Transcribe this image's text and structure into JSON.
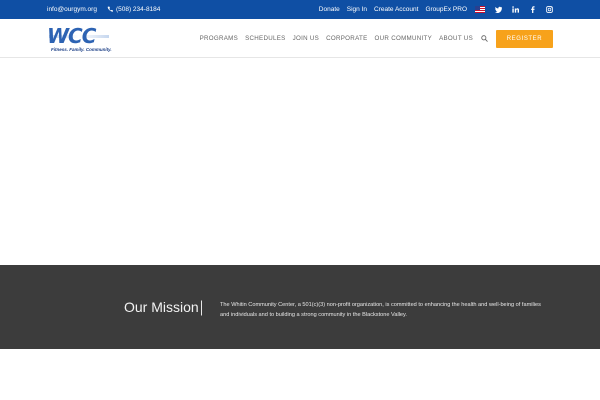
{
  "topbar": {
    "email": "info@ourgym.org",
    "phone": "(508) 234-8184",
    "links": [
      "Donate",
      "Sign In",
      "Create Account",
      "GroupEx PRO"
    ]
  },
  "header": {
    "logo_letters": "WCC",
    "logo_tagline": "Fitness. Family. Community.",
    "nav": [
      "PROGRAMS",
      "SCHEDULES",
      "JOIN US",
      "CORPORATE",
      "OUR COMMUNITY",
      "ABOUT US"
    ],
    "register_label": "REGISTER"
  },
  "mission": {
    "title": "Our Mission",
    "text": "The Whitin Community Center, a 501(c)(3) non-profit organization, is committed to enhancing the health and well-being of families and individuals and to building a strong community in the Blackstone Valley."
  },
  "colors": {
    "topbar": "#0f4fa4",
    "accent": "#f7a21b",
    "mission_band": "#3c3c3c"
  },
  "icons": [
    "phone-icon",
    "us-flag-icon",
    "twitter-icon",
    "linkedin-icon",
    "facebook-icon",
    "instagram-icon",
    "search-icon"
  ]
}
